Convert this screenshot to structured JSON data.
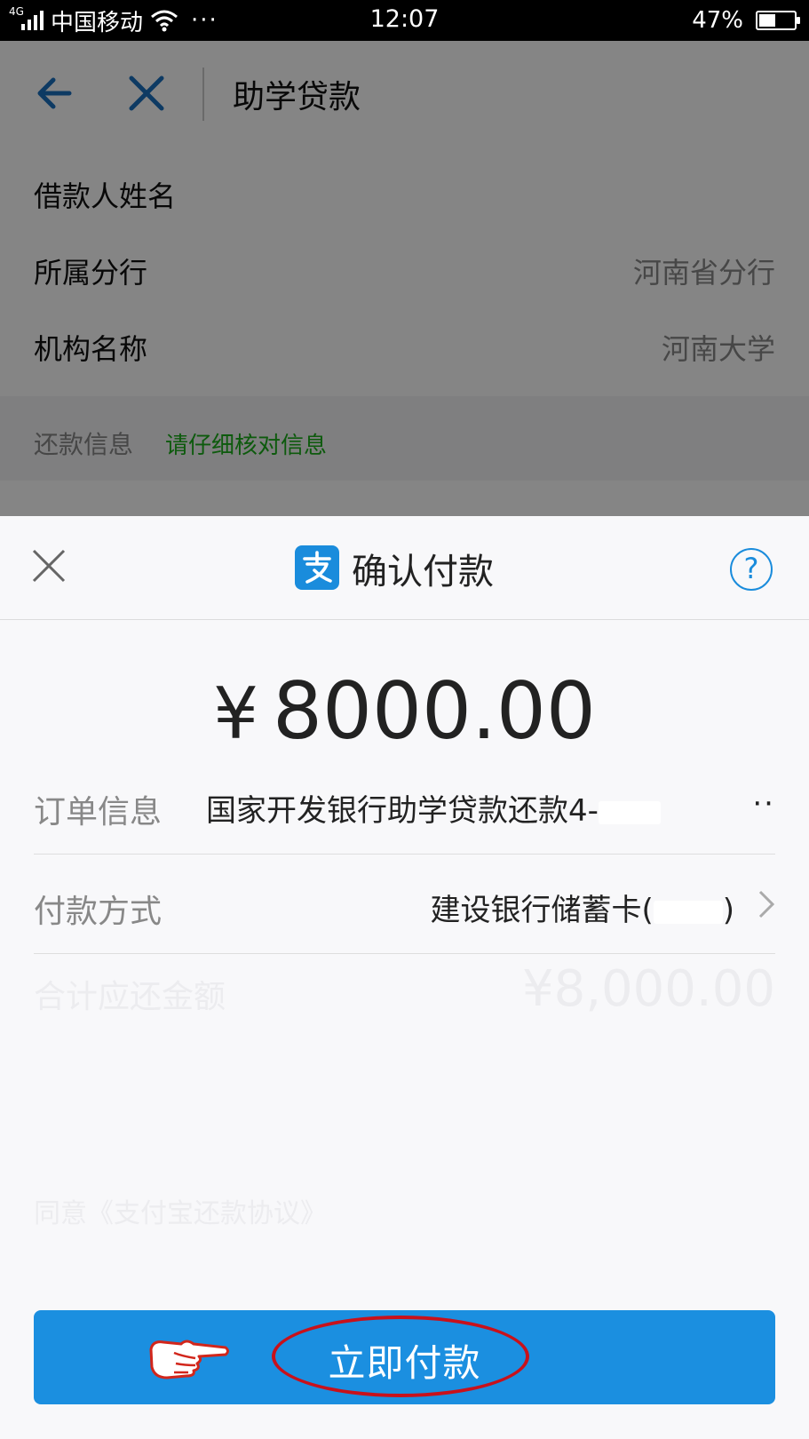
{
  "status_bar": {
    "network": "4G",
    "carrier": "中国移动",
    "more": "···",
    "time": "12:07",
    "battery_text": "47%",
    "battery_level": 0.47
  },
  "nav": {
    "title": "助学贷款"
  },
  "loan_info": {
    "rows": [
      {
        "label": "借款人姓名",
        "value": ""
      },
      {
        "label": "所属分行",
        "value": "河南省分行"
      },
      {
        "label": "机构名称",
        "value": "河南大学"
      }
    ]
  },
  "repay_section": {
    "title": "还款信息",
    "hint": "请仔细核对信息"
  },
  "background_ghost": {
    "total_label": "合计应还金额",
    "total_value": "¥8,000.00",
    "agree_text": "同意《支付宝还款协议》"
  },
  "payment_sheet": {
    "title": "确认付款",
    "help": "?",
    "currency": "¥",
    "amount": "8000.00",
    "order_label": "订单信息",
    "order_value": "国家开发银行助学贷款还款4-",
    "order_tail": "··",
    "method_label": "付款方式",
    "method_value": "建设银行储蓄卡(",
    "method_close": ")",
    "pay_button": "立即付款"
  },
  "colors": {
    "accent_blue": "#1b8fe0",
    "hint_green": "#1aad19",
    "annotation_red": "#c8111b"
  }
}
